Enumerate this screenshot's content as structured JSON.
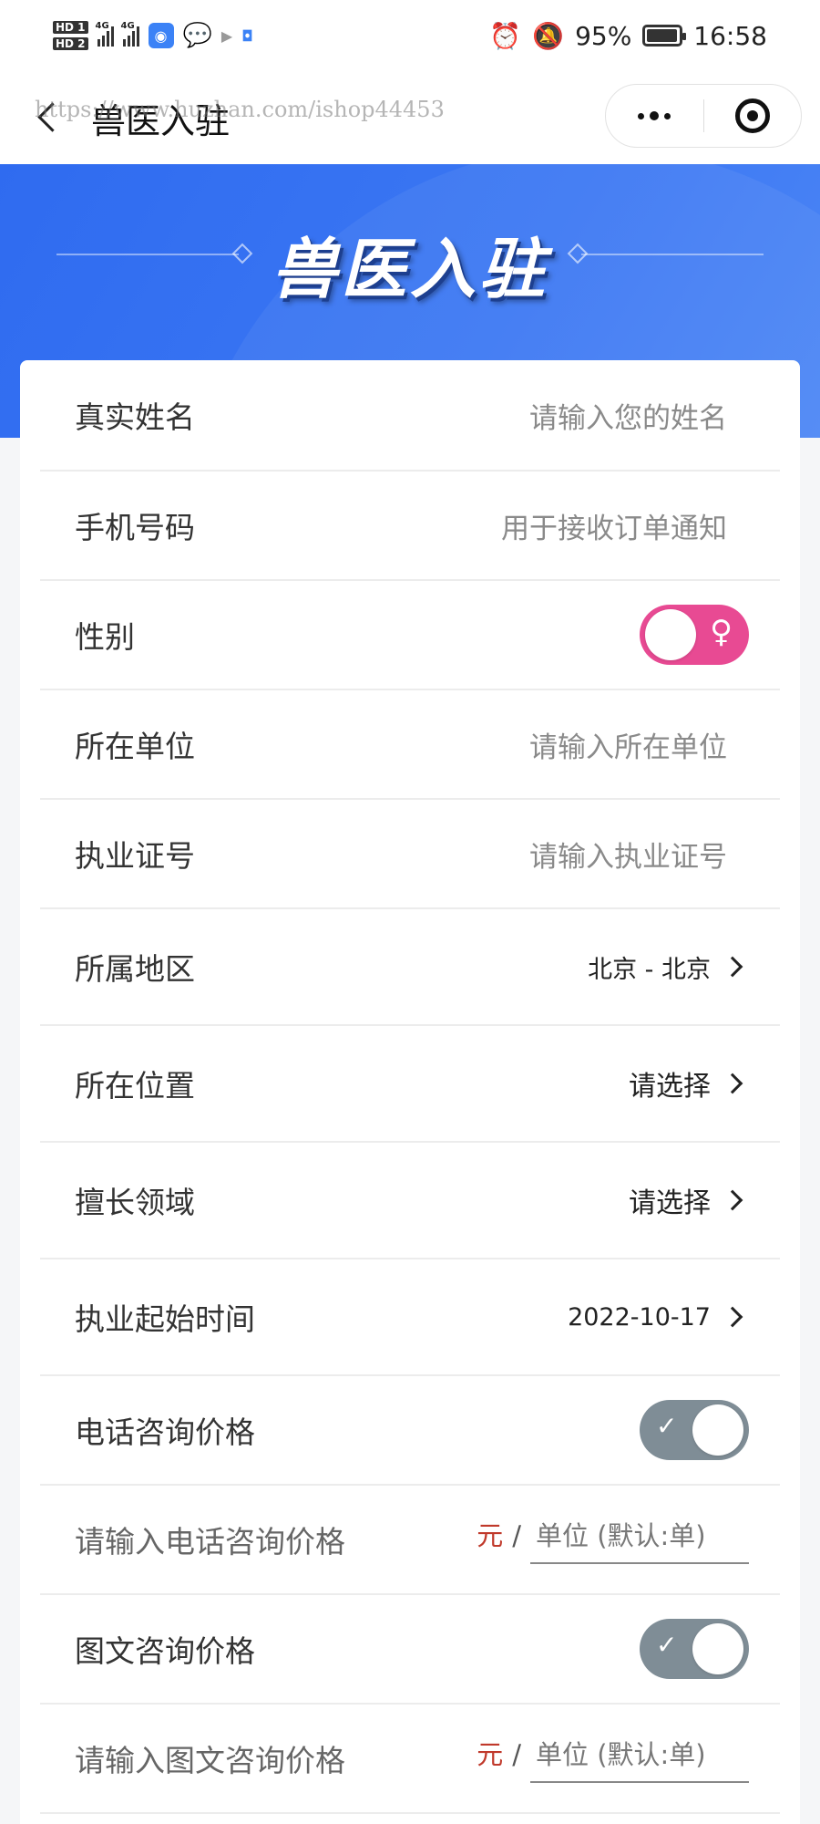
{
  "status_bar": {
    "hd1": "HD 1",
    "hd2": "HD 2",
    "net1": "4G",
    "net2": "4G",
    "battery": "95%",
    "time": "16:58"
  },
  "nav": {
    "title": "兽医入驻",
    "watermark": "https://www.huzhan.com/ishop44453"
  },
  "banner": {
    "title": "兽医入驻"
  },
  "form": {
    "name": {
      "label": "真实姓名",
      "placeholder": "请输入您的姓名"
    },
    "phone": {
      "label": "手机号码",
      "placeholder": "用于接收订单通知"
    },
    "gender": {
      "label": "性别",
      "symbol": "♀"
    },
    "unit": {
      "label": "所在单位",
      "placeholder": "请输入所在单位"
    },
    "license": {
      "label": "执业证号",
      "placeholder": "请输入执业证号"
    },
    "region": {
      "label": "所属地区",
      "value": "北京 - 北京"
    },
    "location": {
      "label": "所在位置",
      "value": "请选择"
    },
    "specialty": {
      "label": "擅长领域",
      "value": "请选择"
    },
    "start_date": {
      "label": "执业起始时间",
      "value": "2022-10-17"
    },
    "phone_consult": {
      "label": "电话咨询价格",
      "check": "✓"
    },
    "phone_price": {
      "label": "请输入电话咨询价格",
      "currency": "元",
      "slash": "/",
      "unit_placeholder": "单位 (默认:单)"
    },
    "text_consult": {
      "label": "图文咨询价格",
      "check": "✓"
    },
    "text_price": {
      "label": "请输入图文咨询价格",
      "currency": "元",
      "slash": "/",
      "unit_placeholder": "单位 (默认:单)"
    }
  },
  "colors": {
    "primary_blue": "#3471f1",
    "toggle_pink": "#e84a93",
    "toggle_gray": "#7f8d96",
    "currency_red": "#c0392b"
  }
}
